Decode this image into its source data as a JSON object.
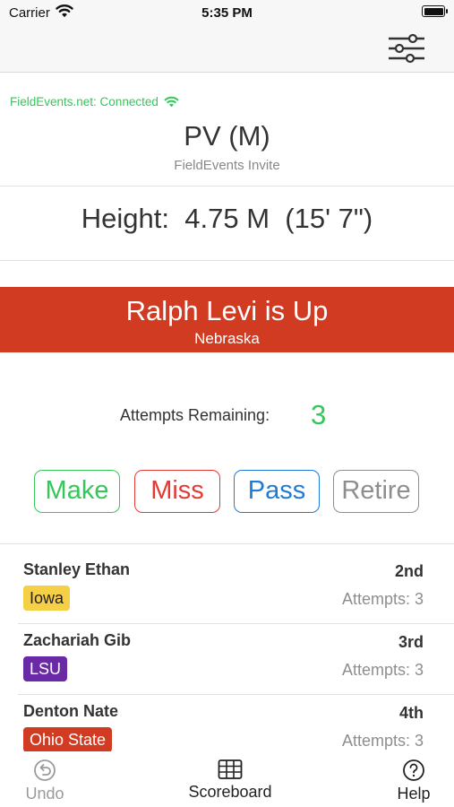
{
  "status_bar": {
    "carrier": "Carrier",
    "time": "5:35 PM"
  },
  "connection": {
    "text": "FieldEvents.net: Connected",
    "color": "#34c759"
  },
  "event": {
    "name": "PV (M)",
    "meet": "FieldEvents Invite"
  },
  "height": {
    "label": "Height:",
    "metric": "4.75 M",
    "imperial": "(15' 7\")"
  },
  "current_athlete": {
    "banner": "Ralph Levi is Up",
    "team": "Nebraska",
    "banner_color": "#d13b22"
  },
  "attempts": {
    "label": "Attempts Remaining:",
    "value": "3"
  },
  "buttons": {
    "make": "Make",
    "miss": "Miss",
    "pass": "Pass",
    "retire": "Retire"
  },
  "standings": [
    {
      "name": "Stanley Ethan",
      "team": "Iowa",
      "team_color": "#f5cf45",
      "team_text_color": "#222222",
      "place": "2nd",
      "attempts": "Attempts: 3"
    },
    {
      "name": "Zachariah Gib",
      "team": "LSU",
      "team_color": "#6a2aa5",
      "team_text_color": "#ffffff",
      "place": "3rd",
      "attempts": "Attempts: 3"
    },
    {
      "name": "Denton Nate",
      "team": "Ohio State",
      "team_color": "#d13b22",
      "team_text_color": "#ffffff",
      "place": "4th",
      "attempts": "Attempts: 3"
    }
  ],
  "tab_bar": {
    "undo": "Undo",
    "scoreboard": "Scoreboard",
    "help": "Help"
  },
  "icons": {
    "wifi": "wifi-icon",
    "battery": "battery-icon",
    "settings": "sliders-icon",
    "undo": "undo-icon",
    "scoreboard": "table-grid-icon",
    "help": "question-circle-icon"
  }
}
